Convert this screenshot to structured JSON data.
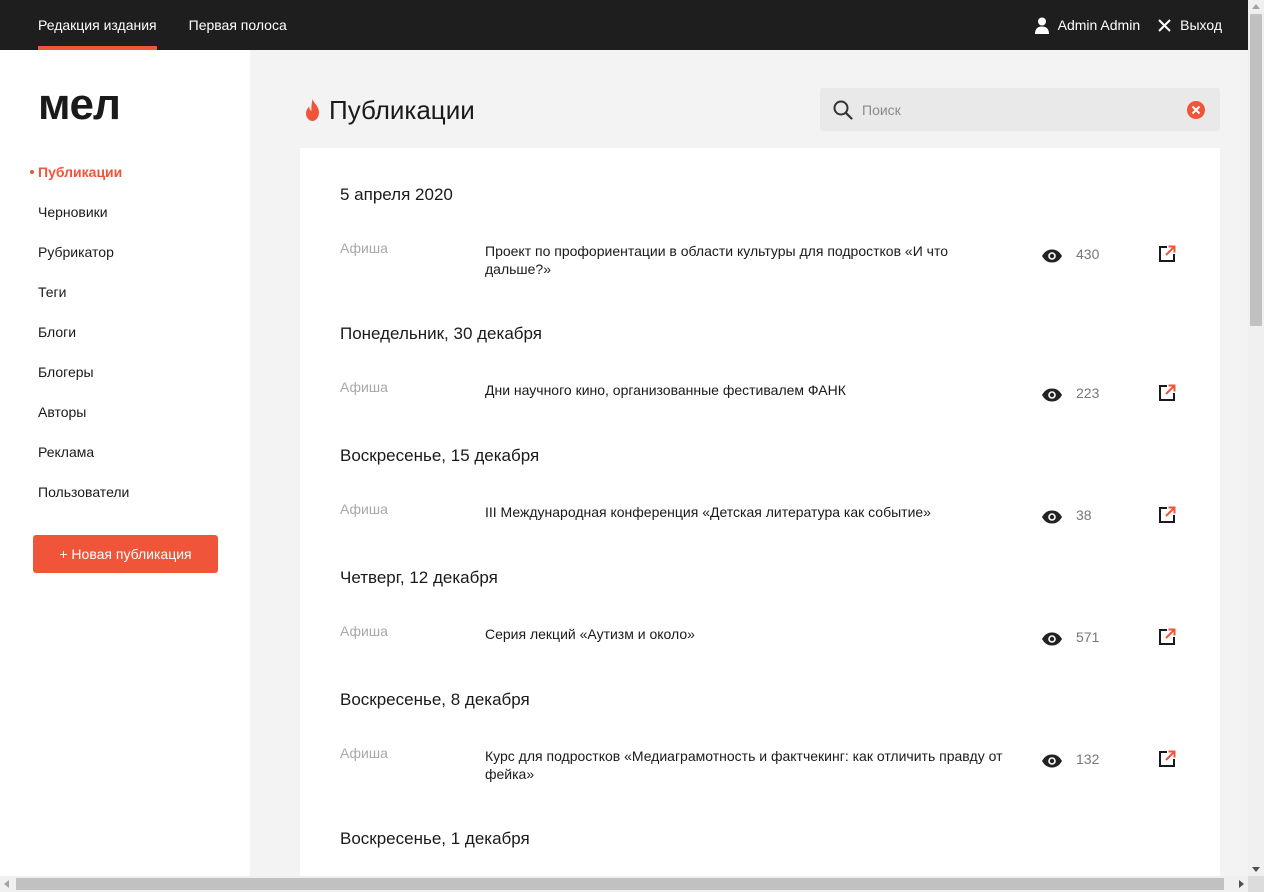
{
  "topbar": {
    "tabs": [
      {
        "label": "Редакция издания",
        "active": true
      },
      {
        "label": "Первая полоса",
        "active": false
      }
    ],
    "user_name": "Admin Admin",
    "logout_label": "Выход",
    "user_icon": "user-icon",
    "logout_icon": "close-icon"
  },
  "sidebar": {
    "logo_text": "мел",
    "items": [
      {
        "label": "Публикации",
        "active": true
      },
      {
        "label": "Черновики"
      },
      {
        "label": "Рубрикатор"
      },
      {
        "label": "Теги"
      },
      {
        "label": "Блоги"
      },
      {
        "label": "Блогеры"
      },
      {
        "label": "Авторы"
      },
      {
        "label": "Реклама"
      },
      {
        "label": "Пользователи"
      }
    ],
    "new_button_label": "+ Новая публикация"
  },
  "header": {
    "title": "Публикации",
    "title_icon": "fire-icon"
  },
  "search": {
    "placeholder": "Поиск",
    "value": ""
  },
  "groups": [
    {
      "date": "5 апреля 2020",
      "items": [
        {
          "rubric": "Афиша",
          "title": "Проект по профориентации в области культуры для подростков «И что дальше?»",
          "views": "430"
        }
      ]
    },
    {
      "date": "Понедельник, 30 декабря",
      "items": [
        {
          "rubric": "Афиша",
          "title": "Дни научного кино, организованные фестивалем ФАНК",
          "views": "223"
        }
      ]
    },
    {
      "date": "Воскресенье, 15 декабря",
      "items": [
        {
          "rubric": "Афиша",
          "title": "III Международная конференция «Детская литература как событие»",
          "views": "38"
        }
      ]
    },
    {
      "date": "Четверг, 12 декабря",
      "items": [
        {
          "rubric": "Афиша",
          "title": "Серия лекций «Аутизм и около»",
          "views": "571"
        }
      ]
    },
    {
      "date": "Воскресенье, 8 декабря",
      "items": [
        {
          "rubric": "Афиша",
          "title": "Курс для подростков «Медиаграмотность и фактчекинг: как отличить правду от фейка»",
          "views": "132"
        }
      ]
    },
    {
      "date": "Воскресенье, 1 декабря",
      "items": []
    }
  ],
  "colors": {
    "accent": "#f0553a",
    "topbar": "#1e1e1e",
    "background": "#f3f3f3"
  }
}
